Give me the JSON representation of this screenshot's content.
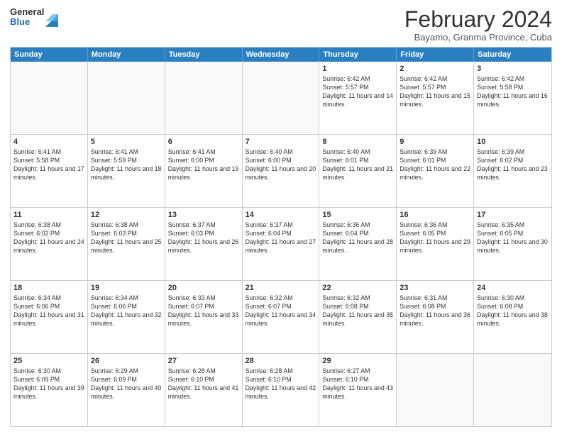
{
  "header": {
    "logo": {
      "line1": "General",
      "line2": "Blue"
    },
    "title": "February 2024",
    "location": "Bayamo, Granma Province, Cuba"
  },
  "calendar": {
    "days_of_week": [
      "Sunday",
      "Monday",
      "Tuesday",
      "Wednesday",
      "Thursday",
      "Friday",
      "Saturday"
    ],
    "weeks": [
      [
        {
          "day": "",
          "info": ""
        },
        {
          "day": "",
          "info": ""
        },
        {
          "day": "",
          "info": ""
        },
        {
          "day": "",
          "info": ""
        },
        {
          "day": "1",
          "info": "Sunrise: 6:42 AM\nSunset: 5:57 PM\nDaylight: 11 hours and 14 minutes."
        },
        {
          "day": "2",
          "info": "Sunrise: 6:42 AM\nSunset: 5:57 PM\nDaylight: 11 hours and 15 minutes."
        },
        {
          "day": "3",
          "info": "Sunrise: 6:42 AM\nSunset: 5:58 PM\nDaylight: 11 hours and 16 minutes."
        }
      ],
      [
        {
          "day": "4",
          "info": "Sunrise: 6:41 AM\nSunset: 5:58 PM\nDaylight: 11 hours and 17 minutes."
        },
        {
          "day": "5",
          "info": "Sunrise: 6:41 AM\nSunset: 5:59 PM\nDaylight: 11 hours and 18 minutes."
        },
        {
          "day": "6",
          "info": "Sunrise: 6:41 AM\nSunset: 6:00 PM\nDaylight: 11 hours and 19 minutes."
        },
        {
          "day": "7",
          "info": "Sunrise: 6:40 AM\nSunset: 6:00 PM\nDaylight: 11 hours and 20 minutes."
        },
        {
          "day": "8",
          "info": "Sunrise: 6:40 AM\nSunset: 6:01 PM\nDaylight: 11 hours and 21 minutes."
        },
        {
          "day": "9",
          "info": "Sunrise: 6:39 AM\nSunset: 6:01 PM\nDaylight: 11 hours and 22 minutes."
        },
        {
          "day": "10",
          "info": "Sunrise: 6:39 AM\nSunset: 6:02 PM\nDaylight: 11 hours and 23 minutes."
        }
      ],
      [
        {
          "day": "11",
          "info": "Sunrise: 6:38 AM\nSunset: 6:02 PM\nDaylight: 11 hours and 24 minutes."
        },
        {
          "day": "12",
          "info": "Sunrise: 6:38 AM\nSunset: 6:03 PM\nDaylight: 11 hours and 25 minutes."
        },
        {
          "day": "13",
          "info": "Sunrise: 6:37 AM\nSunset: 6:03 PM\nDaylight: 11 hours and 26 minutes."
        },
        {
          "day": "14",
          "info": "Sunrise: 6:37 AM\nSunset: 6:04 PM\nDaylight: 11 hours and 27 minutes."
        },
        {
          "day": "15",
          "info": "Sunrise: 6:36 AM\nSunset: 6:04 PM\nDaylight: 11 hours and 28 minutes."
        },
        {
          "day": "16",
          "info": "Sunrise: 6:36 AM\nSunset: 6:05 PM\nDaylight: 11 hours and 29 minutes."
        },
        {
          "day": "17",
          "info": "Sunrise: 6:35 AM\nSunset: 6:05 PM\nDaylight: 11 hours and 30 minutes."
        }
      ],
      [
        {
          "day": "18",
          "info": "Sunrise: 6:34 AM\nSunset: 6:06 PM\nDaylight: 11 hours and 31 minutes."
        },
        {
          "day": "19",
          "info": "Sunrise: 6:34 AM\nSunset: 6:06 PM\nDaylight: 11 hours and 32 minutes."
        },
        {
          "day": "20",
          "info": "Sunrise: 6:33 AM\nSunset: 6:07 PM\nDaylight: 11 hours and 33 minutes."
        },
        {
          "day": "21",
          "info": "Sunrise: 6:32 AM\nSunset: 6:07 PM\nDaylight: 11 hours and 34 minutes."
        },
        {
          "day": "22",
          "info": "Sunrise: 6:32 AM\nSunset: 6:08 PM\nDaylight: 11 hours and 35 minutes."
        },
        {
          "day": "23",
          "info": "Sunrise: 6:31 AM\nSunset: 6:08 PM\nDaylight: 11 hours and 36 minutes."
        },
        {
          "day": "24",
          "info": "Sunrise: 6:30 AM\nSunset: 6:08 PM\nDaylight: 11 hours and 38 minutes."
        }
      ],
      [
        {
          "day": "25",
          "info": "Sunrise: 6:30 AM\nSunset: 6:09 PM\nDaylight: 11 hours and 39 minutes."
        },
        {
          "day": "26",
          "info": "Sunrise: 6:29 AM\nSunset: 6:09 PM\nDaylight: 11 hours and 40 minutes."
        },
        {
          "day": "27",
          "info": "Sunrise: 6:28 AM\nSunset: 6:10 PM\nDaylight: 11 hours and 41 minutes."
        },
        {
          "day": "28",
          "info": "Sunrise: 6:28 AM\nSunset: 6:10 PM\nDaylight: 11 hours and 42 minutes."
        },
        {
          "day": "29",
          "info": "Sunrise: 6:27 AM\nSunset: 6:10 PM\nDaylight: 11 hours and 43 minutes."
        },
        {
          "day": "",
          "info": ""
        },
        {
          "day": "",
          "info": ""
        }
      ]
    ]
  }
}
